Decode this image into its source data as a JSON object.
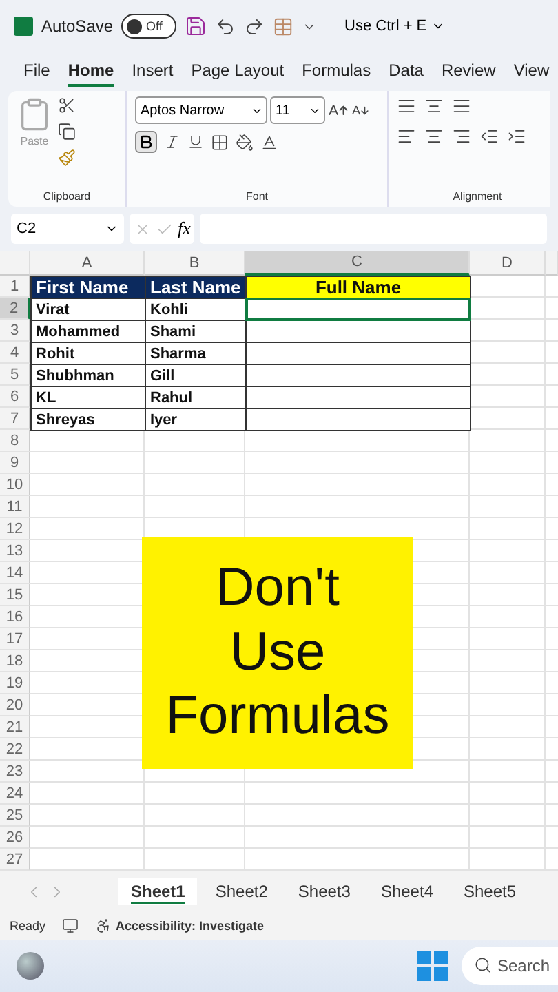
{
  "title_bar": {
    "autosave_label": "AutoSave",
    "autosave_on": false,
    "toggle_text": "Off",
    "title": "Use Ctrl + E"
  },
  "ribbon_tabs": [
    {
      "label": "File",
      "selected": false
    },
    {
      "label": "Home",
      "selected": true
    },
    {
      "label": "Insert",
      "selected": false
    },
    {
      "label": "Page Layout",
      "selected": false
    },
    {
      "label": "Formulas",
      "selected": false
    },
    {
      "label": "Data",
      "selected": false
    },
    {
      "label": "Review",
      "selected": false
    },
    {
      "label": "View",
      "selected": false
    }
  ],
  "ribbon": {
    "paste_label": "Paste",
    "font_name": "Aptos Narrow",
    "font_size": "11",
    "bold_on": true,
    "groups": [
      "Clipboard",
      "Font",
      "Alignment"
    ]
  },
  "formula_bar": {
    "name_box": "C2",
    "fx_label": "fx"
  },
  "columns": [
    "A",
    "B",
    "C",
    "D"
  ],
  "rows": [
    {
      "number": "1",
      "cells": [
        {
          "text": "First Name",
          "color": "#0c2a5e",
          "selected": false
        },
        {
          "text": "Last Name",
          "color": "#0c2a5e",
          "selected": false
        },
        {
          "text": "Full Name",
          "color": "#ffff00",
          "selected": false
        }
      ]
    },
    {
      "number": "2",
      "cells": [
        {
          "text": "Virat",
          "selected": false
        },
        {
          "text": "Kohli",
          "selected": false
        },
        {
          "selected": true
        }
      ]
    },
    {
      "number": "3",
      "cells": [
        {
          "text": "Mohammed",
          "selected": false
        },
        {
          "text": "Shami",
          "selected": false
        },
        {
          "selected": false
        }
      ]
    },
    {
      "number": "4",
      "cells": [
        {
          "text": "Rohit",
          "selected": false
        },
        {
          "text": "Sharma",
          "selected": false
        },
        {
          "selected": false
        }
      ]
    },
    {
      "number": "5",
      "cells": [
        {
          "text": "Shubhman",
          "selected": false
        },
        {
          "text": "Gill",
          "selected": false
        },
        {
          "selected": false
        }
      ]
    },
    {
      "number": "6",
      "cells": [
        {
          "text": "KL",
          "selected": false
        },
        {
          "text": "Rahul",
          "selected": false
        },
        {
          "selected": false
        }
      ]
    },
    {
      "number": "7",
      "cells": [
        {
          "text": "Shreyas",
          "selected": false
        },
        {
          "text": "Iyer",
          "selected": false
        },
        {
          "selected": false
        }
      ]
    },
    {
      "number": "8"
    },
    {
      "number": "9"
    },
    {
      "number": "10"
    },
    {
      "number": "11"
    },
    {
      "number": "12"
    },
    {
      "number": "13"
    },
    {
      "number": "14"
    },
    {
      "number": "15"
    },
    {
      "number": "16"
    },
    {
      "number": "17"
    },
    {
      "number": "18"
    },
    {
      "number": "19"
    },
    {
      "number": "20"
    },
    {
      "number": "21"
    },
    {
      "number": "22"
    },
    {
      "number": "23"
    },
    {
      "number": "24"
    },
    {
      "number": "25"
    },
    {
      "number": "26"
    },
    {
      "number": "27"
    }
  ],
  "overlay_caption": "Don't Use Formulas",
  "sheet_tabs": [
    {
      "label": "Sheet1",
      "selected": true
    },
    {
      "label": "Sheet2",
      "selected": false
    },
    {
      "label": "Sheet3",
      "selected": false
    },
    {
      "label": "Sheet4",
      "selected": false
    },
    {
      "label": "Sheet5",
      "selected": false
    }
  ],
  "status_bar": {
    "ready": "Ready",
    "accessibility": "Accessibility: Investigate"
  },
  "taskbar": {
    "search_placeholder": "Search"
  }
}
